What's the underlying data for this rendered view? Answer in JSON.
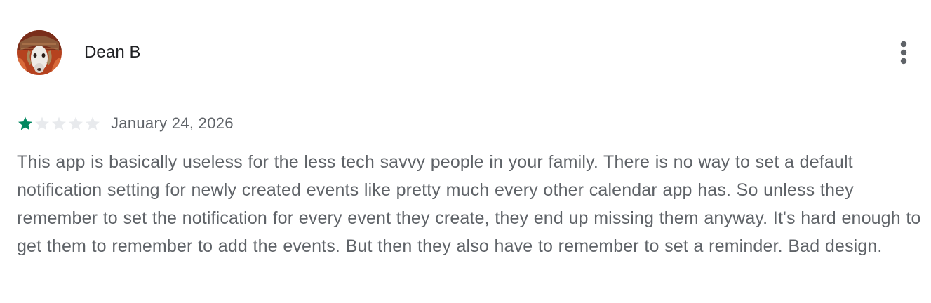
{
  "review": {
    "reviewer_name": "Dean B",
    "avatar_icon": "dog-avatar-icon",
    "more_icon": "more-vert-icon",
    "rating": 1,
    "rating_max": 5,
    "date": "January 24, 2026",
    "text": "This app is basically useless for the less tech savvy people in your family. There is no way to set a default notification setting for newly created events like pretty much every other calendar app has. So unless they remember to set the notification for every event they create, they end up missing them anyway. It's hard enough to get them to remember to add the events. But then they also have to remember to set a reminder. Bad design."
  },
  "colors": {
    "star_filled": "#01875f",
    "star_empty": "#e8eaed",
    "name_text": "#202124",
    "body_text": "#5f6368"
  }
}
